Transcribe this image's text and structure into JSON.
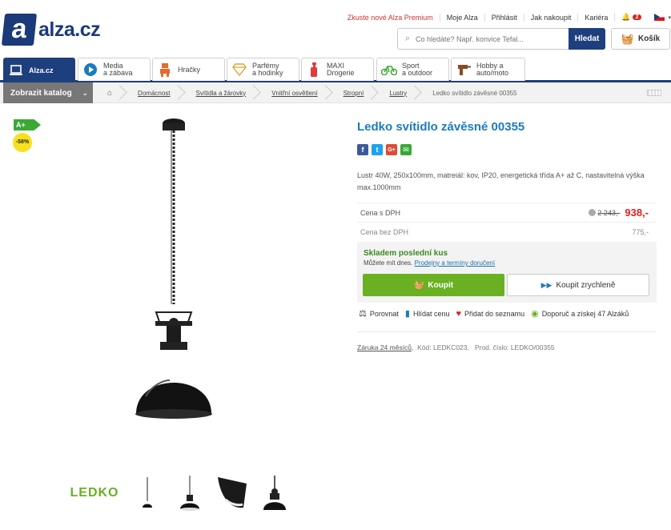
{
  "header": {
    "logo_mark": "a",
    "logo_text": "alza.cz",
    "top_links": [
      "Zkuste nové Alza Premium",
      "Moje Alza",
      "Přihlásit",
      "Jak nakoupit",
      "Kariéra"
    ],
    "notification_count": "2",
    "search_placeholder": "Co hledáte? Např. konvice Tefal...",
    "search_button": "Hledat",
    "cart_label": "Košík"
  },
  "tabs": [
    {
      "l1": "Alza.cz",
      "l2": ""
    },
    {
      "l1": "Media",
      "l2": "a zábava"
    },
    {
      "l1": "Hračky",
      "l2": ""
    },
    {
      "l1": "Parfémy",
      "l2": "a hodinky"
    },
    {
      "l1": "MAXI",
      "l2": "Drogerie"
    },
    {
      "l1": "Sport",
      "l2": "a outdoor"
    },
    {
      "l1": "Hobby a",
      "l2": "auto/moto"
    }
  ],
  "catalog_button": "Zobrazit katalog",
  "breadcrumbs": [
    "Domácnost",
    "Svítidla a žárovky",
    "Vnitřní osvětlení",
    "Stropní",
    "Lustry",
    "Ledko svítidlo závěsné 00355"
  ],
  "badges": {
    "energy": "A+",
    "discount": "-58%"
  },
  "thumb_logo": "LEDKO",
  "product": {
    "title": "Ledko svítidlo závěsné 00355",
    "description": "Lustr 40W, 250x100mm, matreiál: kov, IP20, energetická třída A+ až C, nastavitelná výška max.1000mm",
    "price_vat_label": "Cena s DPH",
    "old_price": "2 243,-",
    "price": "938,-",
    "price_novat_label": "Cena bez DPH",
    "price_novat": "775,-",
    "stock_title": "Skladem poslední kus",
    "stock_sub": "Můžete mít dnes.",
    "stock_link": "Prodejny a termíny doručení",
    "buy_label": "Koupit",
    "quick_buy_label": "Koupit zrychleně",
    "actions": [
      "Porovnat",
      "Hlídat cenu",
      "Přidat do seznamu",
      "Doporuč a získej 47 Alzáků"
    ],
    "warranty": "Záruka 24 měsíců",
    "code": "Kód: LEDKC023,",
    "prod_code": "Prod. číslo: LEDKO/00355"
  },
  "colors": {
    "brand": "#1e3f7d",
    "title": "#1c7bbf",
    "buy": "#6ab023",
    "price": "#e02020"
  }
}
